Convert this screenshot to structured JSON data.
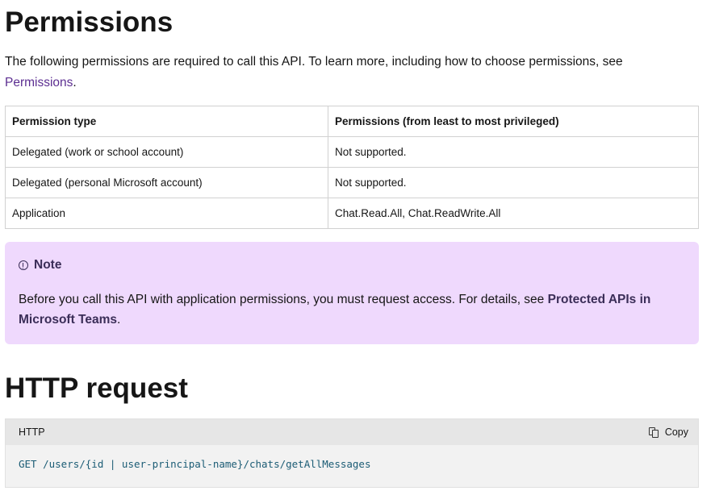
{
  "permissions_section": {
    "title": "Permissions",
    "intro_text": "The following permissions are required to call this API. To learn more, including how to choose permissions, see ",
    "intro_link": "Permissions",
    "intro_suffix": "."
  },
  "permissions_table": {
    "headers": [
      "Permission type",
      "Permissions (from least to most privileged)"
    ],
    "rows": [
      [
        "Delegated (work or school account)",
        "Not supported."
      ],
      [
        "Delegated (personal Microsoft account)",
        "Not supported."
      ],
      [
        "Application",
        "Chat.Read.All, Chat.ReadWrite.All"
      ]
    ]
  },
  "note": {
    "icon": "info-icon",
    "title": "Note",
    "text": "Before you call this API with application permissions, you must request access. For details, see ",
    "link": "Protected APIs in Microsoft Teams",
    "suffix": "."
  },
  "http_section": {
    "title": "HTTP request",
    "code_language": "HTTP",
    "copy_label": "Copy",
    "copy_icon": "copy-icon",
    "code": "GET /users/{id | user-principal-name}/chats/getAllMessages"
  },
  "colors": {
    "link": "#5c2e91",
    "note_background": "#efd9fd",
    "note_text": "#3b2e58",
    "code_text": "#1b5c75"
  }
}
